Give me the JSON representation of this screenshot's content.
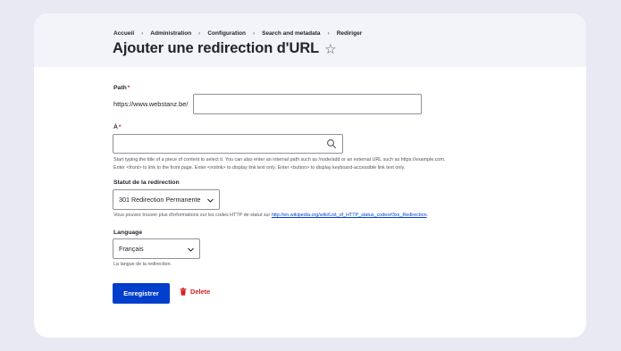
{
  "breadcrumb": {
    "items": [
      "Accueil",
      "Administration",
      "Configuration",
      "Search and metadata",
      "Rediriger"
    ]
  },
  "page": {
    "title": "Ajouter une redirection d'URL",
    "star_glyph": "☆"
  },
  "form": {
    "path": {
      "label": "Path",
      "required_marker": "*",
      "prefix": "https://www.webstanz.be/",
      "value": ""
    },
    "to": {
      "label": "À",
      "required_marker": "*",
      "value": "",
      "description_line1": "Start typing the title of a piece of content to select it. You can also enter an internal path such as /node/add or an external URL such as https://example.com.",
      "description_line2": "Enter <front> to link to the front page. Enter <nolink> to display link text only. Enter <button> to display keyboard-accessible link text only."
    },
    "status": {
      "label": "Statut de la redirection",
      "selected": "301 Redirection Permanente",
      "description_prefix": "Vous pouvez trouver plus d'informations sur les codes HTTP de statut sur ",
      "link_text": "http://en.wikipedia.org/wiki/List_of_HTTP_status_codes#3xx_Redirection",
      "description_suffix": "."
    },
    "language": {
      "label": "Language",
      "selected": "Français",
      "description": "La langue de la redirection."
    }
  },
  "actions": {
    "save_label": "Enregistrer",
    "delete_label": "Delete"
  },
  "colors": {
    "primary": "#003ecc",
    "danger": "#d72222",
    "header_bg": "#f3f4f9",
    "page_bg": "#e9e9f3"
  }
}
